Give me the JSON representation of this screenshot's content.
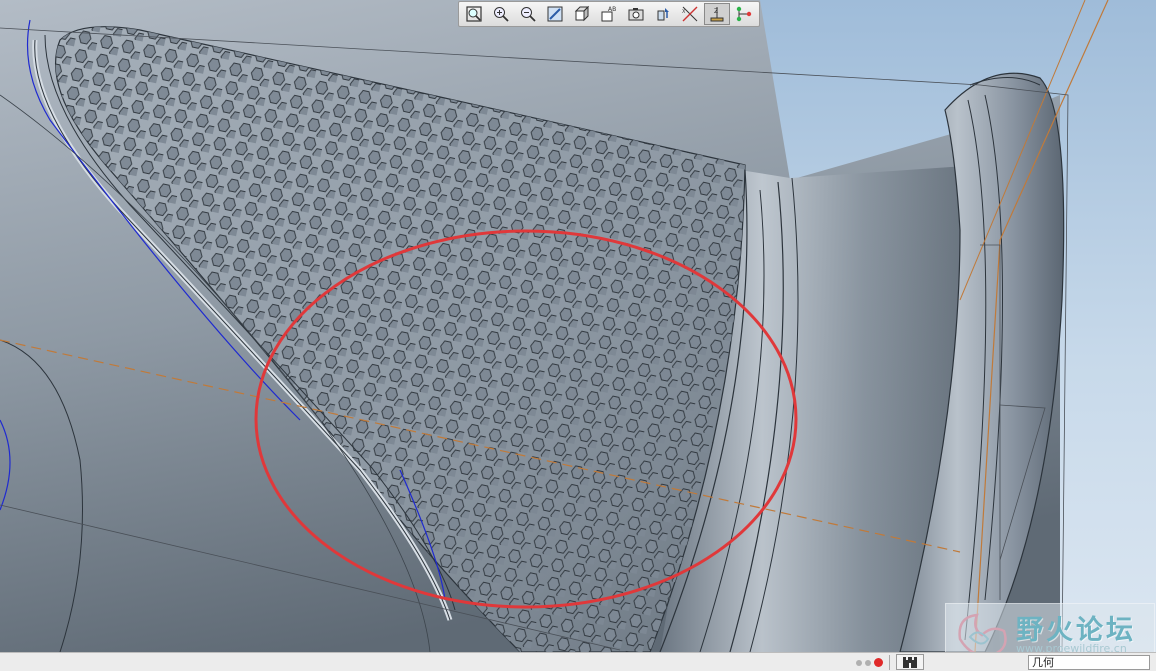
{
  "viewport": {
    "background_top": "#9fbcd9",
    "background_bottom": "#dbe6f1",
    "model_color": "#8e99a4",
    "annotation_color": "#e0383a",
    "datum_color": "#c07a3a"
  },
  "toolbar": {
    "buttons": [
      {
        "icon": "refit-icon",
        "tooltip": ""
      },
      {
        "icon": "zoom-in-icon",
        "tooltip": ""
      },
      {
        "icon": "zoom-out-icon",
        "tooltip": ""
      },
      {
        "icon": "repaint-icon",
        "tooltip": ""
      },
      {
        "icon": "display-style-icon",
        "tooltip": ""
      },
      {
        "icon": "saved-views-icon",
        "tooltip": ""
      },
      {
        "icon": "camera-icon",
        "tooltip": ""
      },
      {
        "icon": "spin-center-icon",
        "tooltip": ""
      },
      {
        "icon": "datum-display-icon",
        "tooltip": ""
      },
      {
        "icon": "annotation-display-icon",
        "tooltip": ""
      },
      {
        "icon": "network-icon",
        "tooltip": ""
      }
    ]
  },
  "watermark": {
    "title": "野火论坛",
    "url": "www.proewildfire.cn"
  },
  "statusbar": {
    "filter_value": "几何"
  }
}
